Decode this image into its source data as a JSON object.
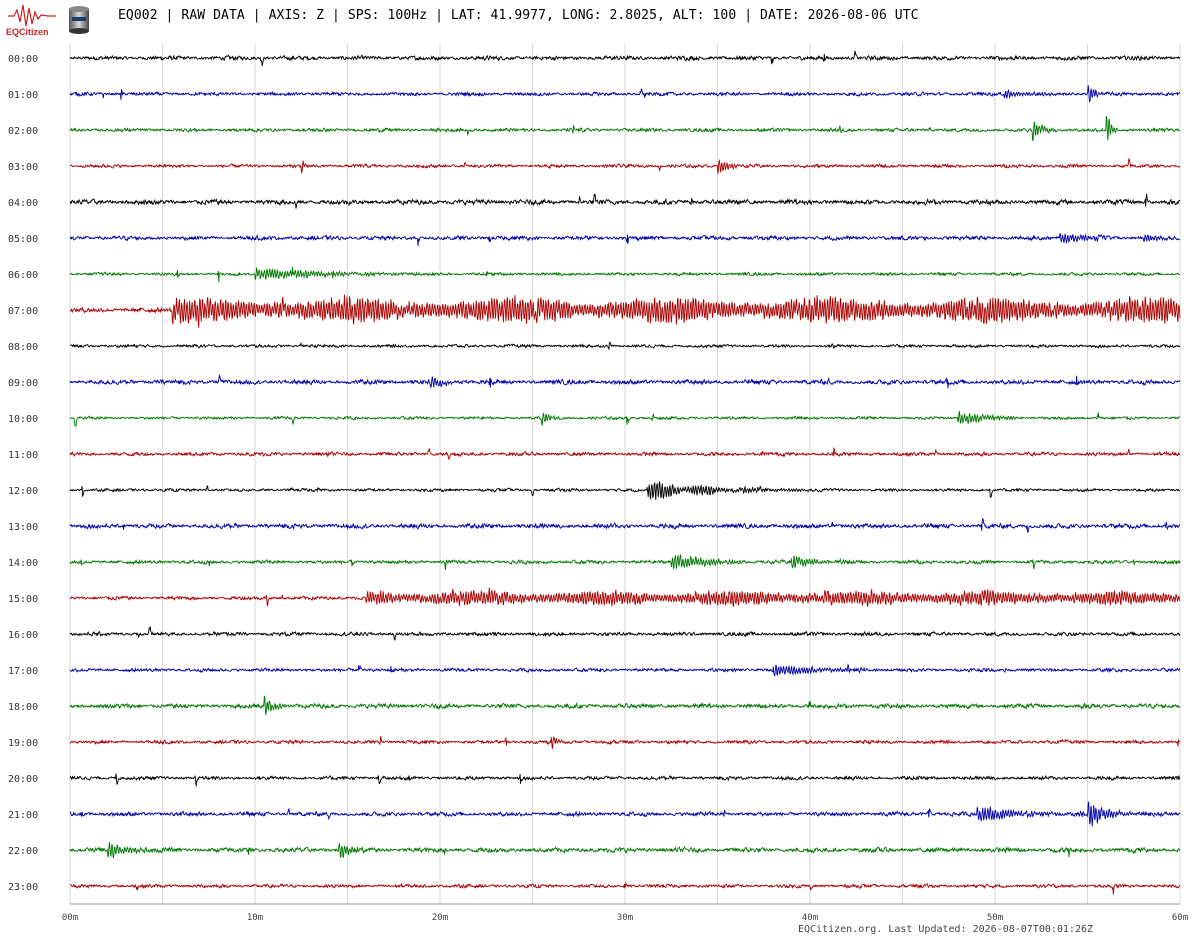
{
  "brand": {
    "name": "EQCitizen"
  },
  "header": {
    "station": "EQ002",
    "data_type": "RAW DATA",
    "axis": "Z",
    "sps": "100Hz",
    "lat": "41.9977",
    "long": "2.8025",
    "alt": "100",
    "date": "2026-08-06 UTC",
    "text": "EQ002 | RAW DATA | AXIS: Z | SPS: 100Hz | LAT: 41.9977, LONG: 2.8025, ALT: 100 | DATE: 2026-08-06 UTC"
  },
  "footer": {
    "text": "EQCitizen.org. Last Updated: 2026-08-07T00:01:26Z"
  },
  "colors": {
    "cycle": [
      "#000000",
      "#0000aa",
      "#007700",
      "#aa0000"
    ],
    "grid": "#d9d9d9",
    "logo": "#cc2222"
  },
  "chart_data": {
    "type": "line",
    "x_ticks": [
      "00m",
      "10m",
      "20m",
      "30m",
      "40m",
      "50m",
      "60m"
    ],
    "x_range_minutes": [
      0,
      60
    ],
    "grid": true,
    "rows": [
      {
        "label": "00:00",
        "events": []
      },
      {
        "label": "01:00",
        "events": [
          {
            "t": 50.5,
            "amp": 7,
            "dur": 2.5
          },
          {
            "t": 55.0,
            "amp": 20,
            "dur": 0.8
          }
        ]
      },
      {
        "label": "02:00",
        "events": [
          {
            "t": 52.0,
            "amp": 16,
            "dur": 1.5
          },
          {
            "t": 56.0,
            "amp": 30,
            "dur": 0.6
          }
        ]
      },
      {
        "label": "03:00",
        "events": [
          {
            "t": 35.0,
            "amp": 14,
            "dur": 1.2
          },
          {
            "t": 12.5,
            "amp": 12,
            "dur": 0.3
          }
        ]
      },
      {
        "label": "04:00",
        "events": []
      },
      {
        "label": "05:00",
        "events": [
          {
            "t": 53.5,
            "amp": 9,
            "dur": 3.0
          },
          {
            "t": 58.0,
            "amp": 6,
            "dur": 2.0
          }
        ]
      },
      {
        "label": "06:00",
        "events": [
          {
            "t": 10.0,
            "amp": 8,
            "dur": 10.0
          }
        ]
      },
      {
        "label": "07:00",
        "events": [
          {
            "t": 5.5,
            "amp": 18,
            "dur": 55.0,
            "mode": "tremor"
          }
        ]
      },
      {
        "label": "08:00",
        "events": []
      },
      {
        "label": "09:00",
        "events": [
          {
            "t": 19.5,
            "amp": 8,
            "dur": 2.0
          }
        ]
      },
      {
        "label": "10:00",
        "events": [
          {
            "t": 48.0,
            "amp": 9,
            "dur": 4.0
          },
          {
            "t": 25.5,
            "amp": 10,
            "dur": 1.0
          }
        ]
      },
      {
        "label": "11:00",
        "events": []
      },
      {
        "label": "12:00",
        "events": [
          {
            "t": 31.2,
            "amp": 18,
            "dur": 10.0,
            "mode": "quake"
          }
        ]
      },
      {
        "label": "13:00",
        "events": []
      },
      {
        "label": "14:00",
        "events": [
          {
            "t": 32.5,
            "amp": 14,
            "dur": 4.0
          },
          {
            "t": 39.0,
            "amp": 10,
            "dur": 3.0
          }
        ]
      },
      {
        "label": "15:00",
        "events": [
          {
            "t": 16.0,
            "amp": 10,
            "dur": 44.0,
            "mode": "tremor"
          }
        ]
      },
      {
        "label": "16:00",
        "events": []
      },
      {
        "label": "17:00",
        "events": [
          {
            "t": 38.0,
            "amp": 9,
            "dur": 6.0
          }
        ]
      },
      {
        "label": "18:00",
        "events": [
          {
            "t": 10.5,
            "amp": 14,
            "dur": 1.5
          }
        ]
      },
      {
        "label": "19:00",
        "events": [
          {
            "t": 26.0,
            "amp": 12,
            "dur": 0.8
          }
        ]
      },
      {
        "label": "20:00",
        "events": []
      },
      {
        "label": "21:00",
        "events": [
          {
            "t": 49.0,
            "amp": 11,
            "dur": 6.0
          },
          {
            "t": 55.0,
            "amp": 18,
            "dur": 2.5
          }
        ]
      },
      {
        "label": "22:00",
        "events": [
          {
            "t": 2.0,
            "amp": 12,
            "dur": 2.5
          },
          {
            "t": 14.5,
            "amp": 14,
            "dur": 1.5
          }
        ]
      },
      {
        "label": "23:00",
        "events": []
      }
    ]
  }
}
